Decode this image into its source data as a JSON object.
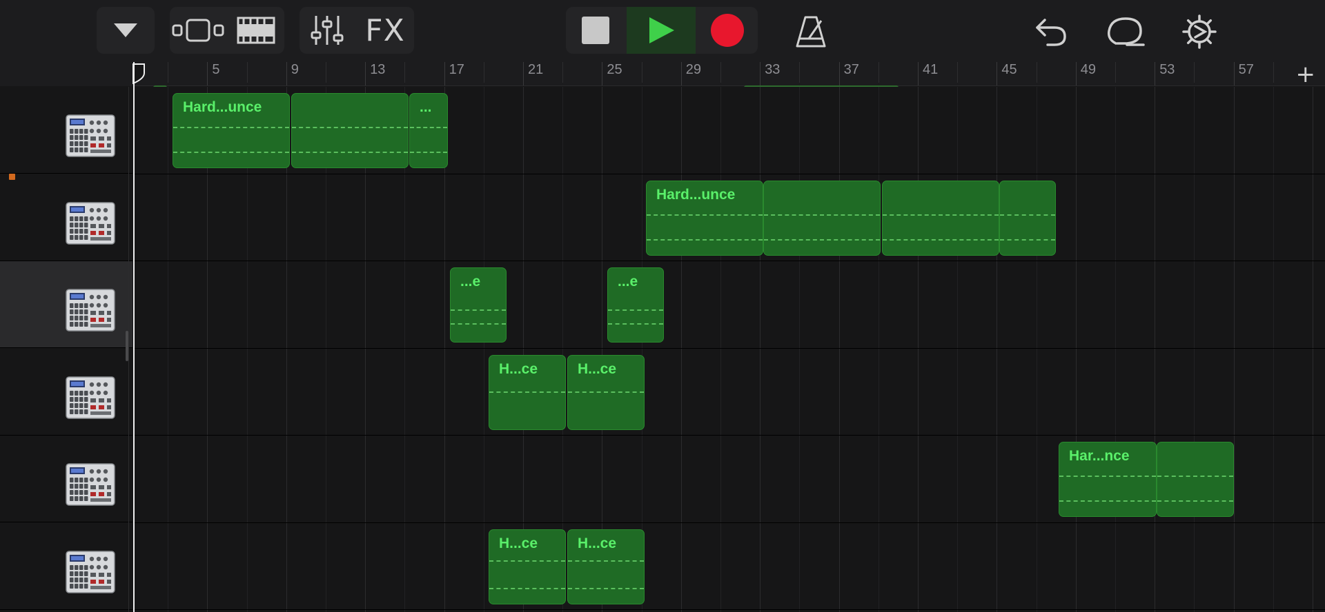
{
  "toolbar": {
    "fx_label": "FX",
    "icons": {
      "tracks_menu": "triangle-down-icon",
      "view_toggle": "browser-view-icon",
      "tracks_view": "tracks-view-icon",
      "mixer": "mixer-sliders-icon",
      "stop": "stop-icon",
      "play": "play-icon",
      "record": "record-icon",
      "metronome": "metronome-icon",
      "undo": "undo-icon",
      "loop_browser": "loop-icon",
      "settings": "gear-icon"
    }
  },
  "ruler": {
    "bar_numbers": [
      "5",
      "9",
      "13",
      "17",
      "21",
      "25",
      "29",
      "33",
      "37",
      "41",
      "45",
      "49",
      "53",
      "57"
    ],
    "add_track_label": "+"
  },
  "colors": {
    "accent_green": "#5af06a",
    "region_fill": "#1f6b25",
    "record_red": "#e8172d",
    "play_green": "#3fd04a"
  },
  "tracks": [
    {
      "instrument": "drum-machine-icon",
      "selected": false,
      "regions": [
        {
          "label": "Hard...unce"
        },
        {
          "label": ""
        },
        {
          "label": "..."
        }
      ]
    },
    {
      "instrument": "drum-machine-icon",
      "selected": false,
      "regions": [
        {
          "label": "Hard...unce"
        },
        {
          "label": ""
        },
        {
          "label": ""
        },
        {
          "label": ""
        }
      ]
    },
    {
      "instrument": "drum-machine-icon",
      "selected": true,
      "regions": [
        {
          "label": "...e"
        },
        {
          "label": "...e"
        }
      ]
    },
    {
      "instrument": "drum-machine-icon",
      "selected": false,
      "regions": [
        {
          "label": "H...ce"
        },
        {
          "label": "H...ce"
        }
      ]
    },
    {
      "instrument": "drum-machine-icon",
      "selected": false,
      "regions": [
        {
          "label": "Har...nce"
        },
        {
          "label": ""
        }
      ]
    },
    {
      "instrument": "drum-machine-icon",
      "selected": false,
      "regions": [
        {
          "label": "H...ce"
        },
        {
          "label": "H...ce"
        }
      ]
    }
  ]
}
